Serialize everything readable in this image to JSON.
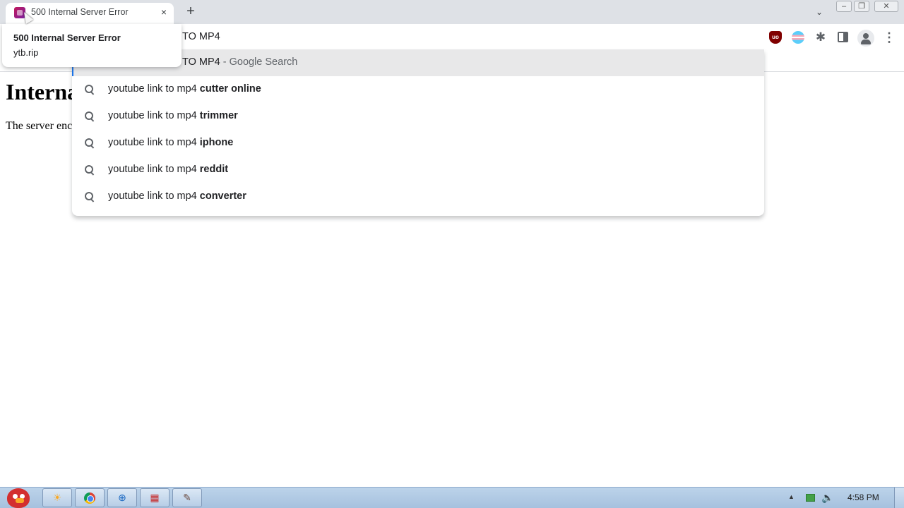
{
  "browser": {
    "tab": {
      "title": "500 Internal Server Error",
      "close_icon": "×",
      "favicon": "ytb-rip-favicon"
    },
    "new_tab_icon": "+",
    "tab_search_icon": "⌄",
    "window_controls": {
      "minimize": "–",
      "restore": "❐",
      "close": "✕"
    },
    "omnibox_text": "TO MP4",
    "extensions": {
      "ublock_label": "uo",
      "puzzle_icon": "✱"
    },
    "menu_icon": "⋮",
    "accent_color": "#1a73e8"
  },
  "hover_card": {
    "title": "500 Internal Server Error",
    "domain": "ytb.rip"
  },
  "suggestions": {
    "selected": {
      "text": "TO MP4",
      "suffix": " - Google Search"
    },
    "items": [
      {
        "prefix": "youtube link to mp4 ",
        "bold": "cutter online"
      },
      {
        "prefix": "youtube link to mp4 ",
        "bold": "trimmer"
      },
      {
        "prefix": "youtube link to mp4 ",
        "bold": "iphone"
      },
      {
        "prefix": "youtube link to mp4 ",
        "bold": "reddit"
      },
      {
        "prefix": "youtube link to mp4 ",
        "bold": "converter"
      }
    ]
  },
  "page": {
    "heading": "Interna",
    "text": "The server enc"
  },
  "taskbar": {
    "clock": "4:58 PM"
  }
}
